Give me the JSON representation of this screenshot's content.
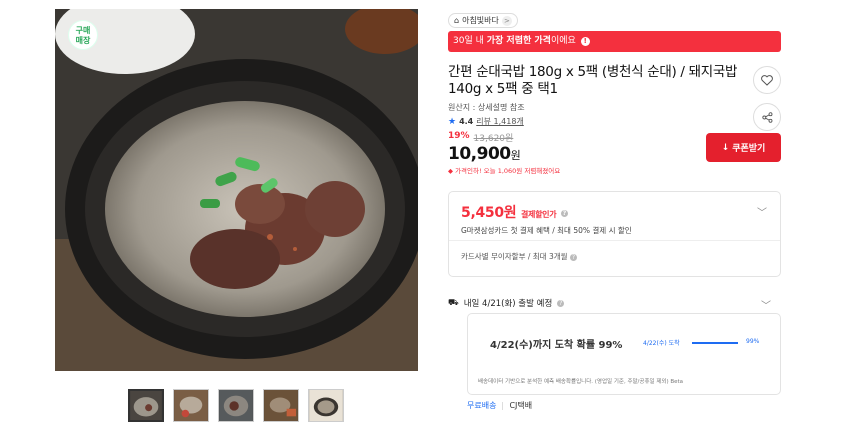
{
  "gallery": {
    "purchase_badge": "구매\n매장",
    "thumbnails": [
      "thumb-1",
      "thumb-2",
      "thumb-3",
      "thumb-4",
      "thumb-5"
    ],
    "active_thumb_index": 0
  },
  "store": {
    "name": "아침빛바다",
    "chevron": ">"
  },
  "banner": {
    "prefix": "30일 내 ",
    "highlight": "가장 저렴한 가격",
    "suffix": "이에요",
    "info_icon": "!"
  },
  "product": {
    "title": "간편 순대국밥 180g x 5팩 (병천식 순대) / 돼지국밥 140g x 5팩 중 택1",
    "origin": "원산지 : 상세설명 참조",
    "rating": "4.4",
    "reviews": "리뷰 1,418개",
    "discount_pct": "19%",
    "original_price": "13,620원",
    "price": "10,900",
    "price_unit": "원",
    "price_drop": "가격인하! 오늘 1,060원 저렴해졌어요"
  },
  "coupon": {
    "label": "쿠폰받기",
    "icon": "↓"
  },
  "card_offer": {
    "price": "5,450원",
    "label": "결제할인가",
    "subtext": "G마켓삼성카드 첫 결제 혜택 / 최대 50% 결제 시 할인",
    "installment": "카드사별 무이자할부 / 최대 3개월"
  },
  "shipping": {
    "title": "내일 4/21(화) 출발 예정",
    "probability_text": "4/22(수)까지 도착 확률 99%",
    "probability_date": "4/22(수) 도착",
    "probability_pct": "99%",
    "probability_value": 0.99,
    "note": "배송데이터 기반으로 분석한 예측 배송확률입니다. (영업일 기준, 주말/공휴일 제외) Beta",
    "free": "무료배송",
    "carrier": "CJ택배"
  },
  "colors": {
    "accent_red": "#f4303e",
    "blue": "#1e6cf2"
  }
}
